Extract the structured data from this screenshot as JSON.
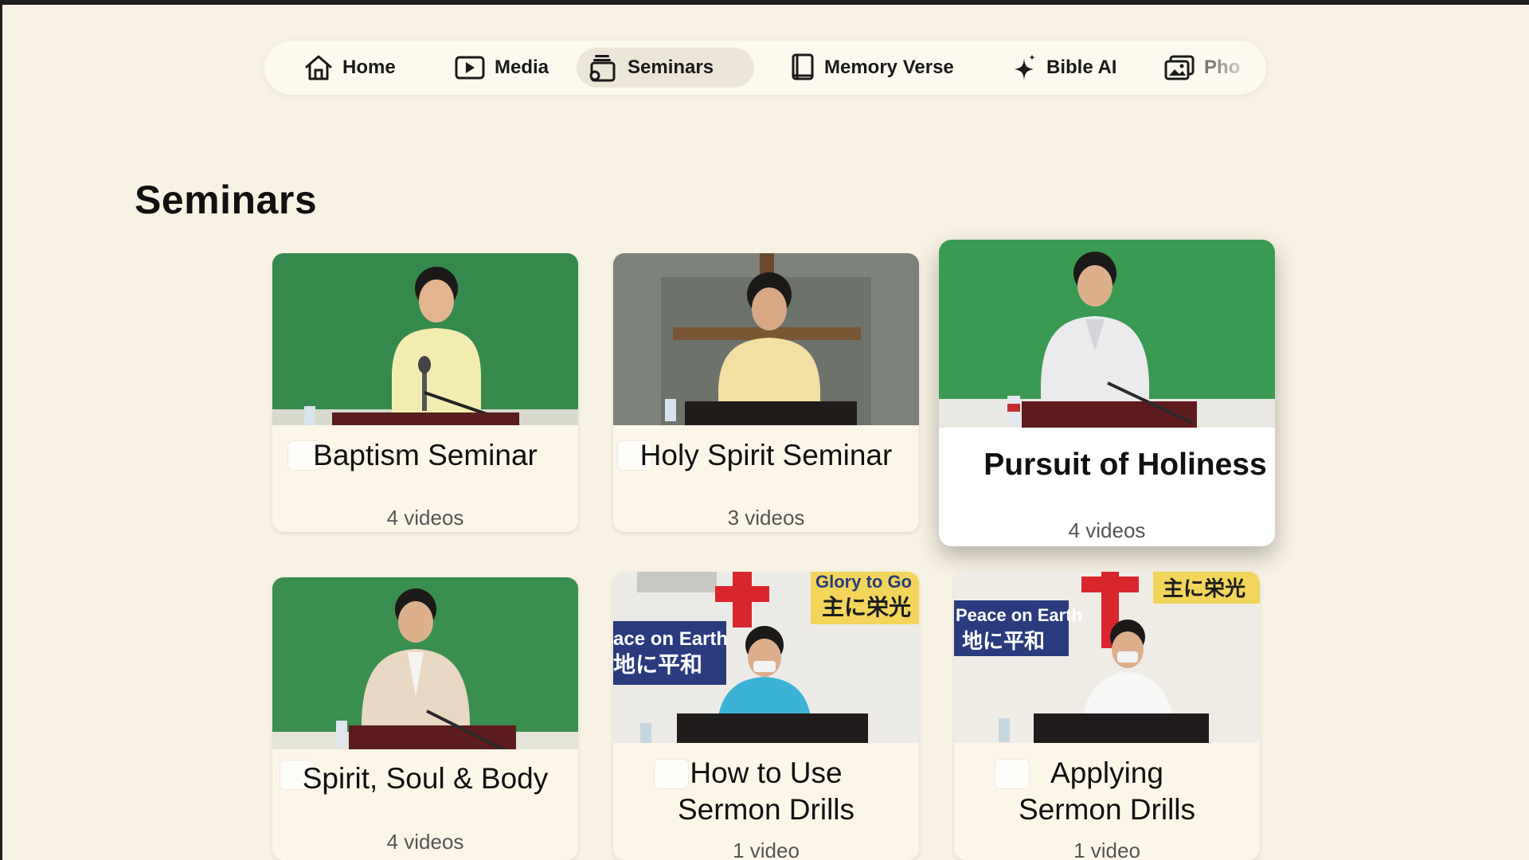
{
  "nav": {
    "items": [
      {
        "label": "Home",
        "icon": "home-icon"
      },
      {
        "label": "Media",
        "icon": "play-icon"
      },
      {
        "label": "Seminars",
        "icon": "seminars-icon",
        "active": true
      },
      {
        "label": "Memory Verse",
        "icon": "book-icon"
      },
      {
        "label": "Bible AI",
        "icon": "sparkle-icon"
      },
      {
        "label": "Pho",
        "icon": "photos-icon"
      }
    ]
  },
  "section": {
    "title": "Seminars"
  },
  "cards": [
    {
      "title": "Baptism Seminar",
      "count": "4 videos"
    },
    {
      "title": "Holy Spirit Seminar",
      "count": "3 videos"
    },
    {
      "title": "Pursuit of Holiness",
      "count": "4 videos",
      "focused": true
    },
    {
      "title": "Spirit, Soul & Body",
      "count": "4 videos"
    },
    {
      "title_line1": "How to Use",
      "title_line2": "Sermon Drills",
      "count": "1 video"
    },
    {
      "title_line1": "Applying",
      "title_line2": "Sermon Drills",
      "count": "1 video"
    }
  ],
  "thumb_text": {
    "banner_left": "Peace on Earth",
    "banner_left_jp": "地に平和",
    "banner_right": "Glory to God",
    "banner_right_jp": "主に栄光",
    "banner_left_cropped": "ace on Earth",
    "banner_left_jp_cropped": "地に平和",
    "banner_right_cropped": "Glory to Go",
    "banner_right_jp_cropped": "主に栄光"
  },
  "colors": {
    "background": "#f8f2e4",
    "card": "#fcf6e8",
    "card_focused": "#ffffff",
    "nav_active": "#ece6d8",
    "chalkboard_green": "#3d9a55",
    "cross_red": "#e0202a"
  }
}
